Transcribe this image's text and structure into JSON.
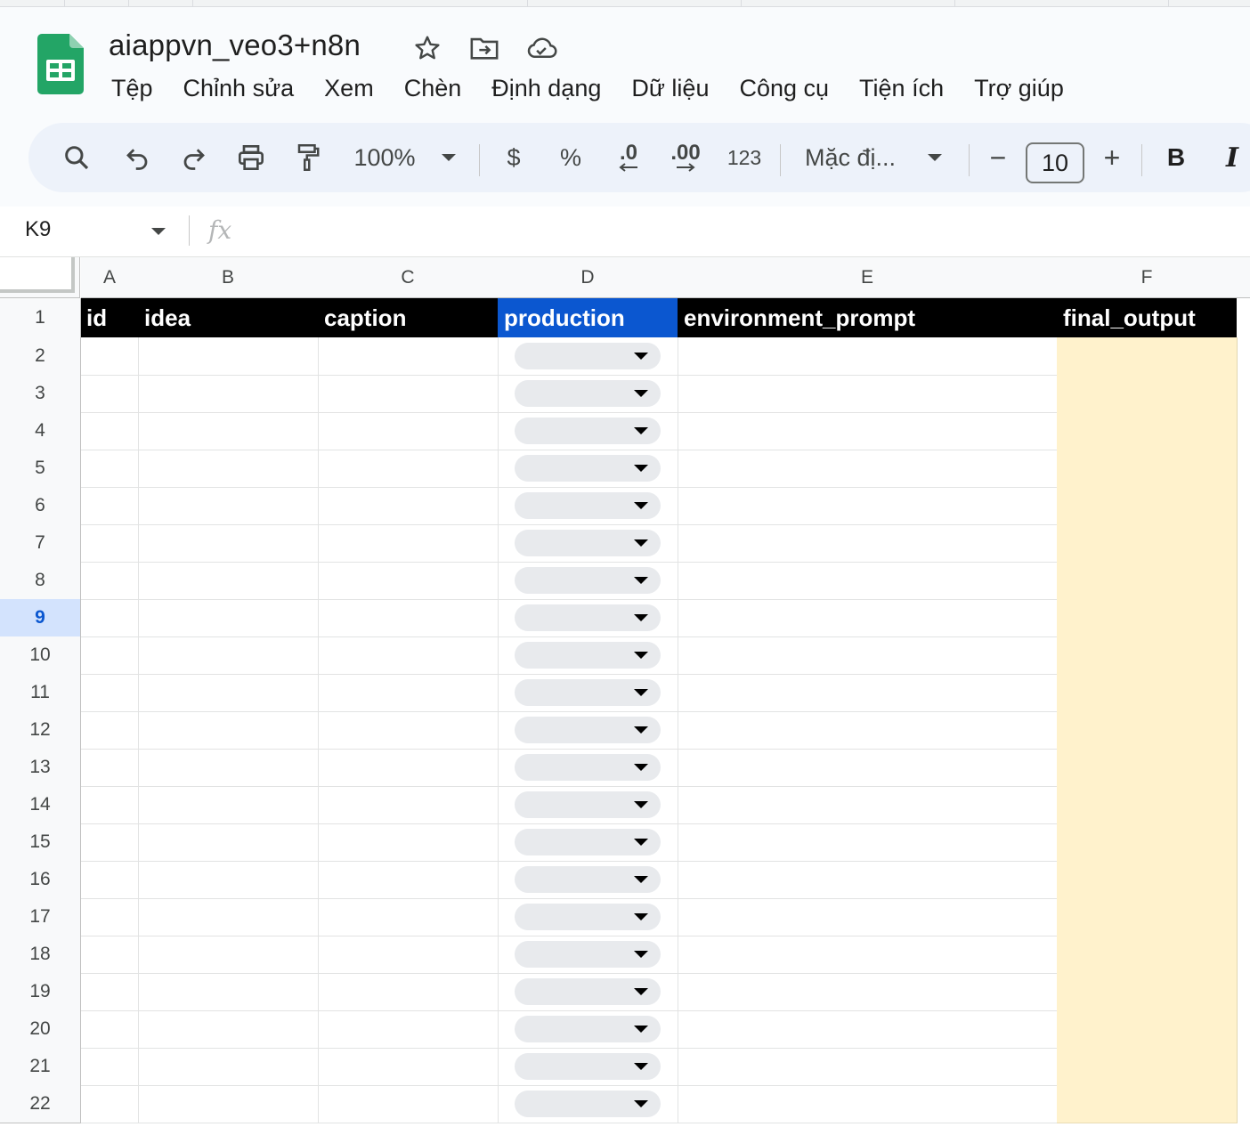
{
  "document": {
    "title": "aiappvn_veo3+n8n"
  },
  "header_icons": [
    "star-icon",
    "move-to-folder-icon",
    "cloud-saved-icon"
  ],
  "menu": [
    "Tệp",
    "Chỉnh sửa",
    "Xem",
    "Chèn",
    "Định dạng",
    "Dữ liệu",
    "Công cụ",
    "Tiện ích",
    "Trợ giúp"
  ],
  "toolbar": {
    "zoom": "100%",
    "currency": "$",
    "percent": "%",
    "decrease_decimal": ".0",
    "increase_decimal": ".00",
    "number_format": "123",
    "font": "Mặc đị...",
    "font_size": "10",
    "minus": "−",
    "plus": "+",
    "bold": "B",
    "italic": "I"
  },
  "formula_bar": {
    "name_box": "K9",
    "fx": "fx",
    "formula": ""
  },
  "sheet": {
    "columns": [
      "A",
      "B",
      "C",
      "D",
      "E",
      "F"
    ],
    "headers": [
      "id",
      "idea",
      "caption",
      "production",
      "environment_prompt",
      "final_output"
    ],
    "rows": [
      "1",
      "2",
      "3",
      "4",
      "5",
      "6",
      "7",
      "8",
      "9",
      "10",
      "11",
      "12",
      "13",
      "14",
      "15",
      "16",
      "17",
      "18",
      "19",
      "20",
      "21",
      "22"
    ],
    "selected_row": "9",
    "highlight_color": "#fff2cc",
    "header_fill": "#000000",
    "selected_header_fill": "#0b57d0"
  }
}
